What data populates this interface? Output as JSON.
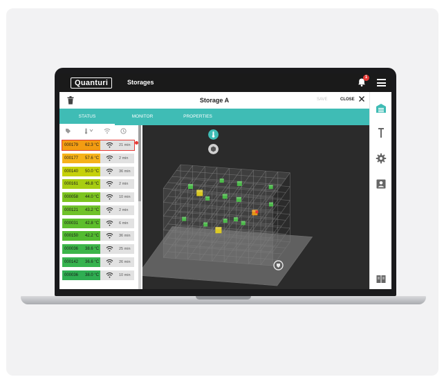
{
  "app": {
    "logo": "Quanturi",
    "section_title": "Storages",
    "notification_count": "1"
  },
  "header": {
    "title": "Storage A",
    "save_label": "SAVE",
    "close_label": "CLOSE"
  },
  "tabs": [
    {
      "label": "STATUS",
      "active": true
    },
    {
      "label": "MONITOR",
      "active": false
    },
    {
      "label": "PROPERTIES",
      "active": false
    }
  ],
  "list_columns": [
    "tag-icon",
    "temperature-icon",
    "signal-icon",
    "clock-icon"
  ],
  "sensors": [
    {
      "id": "000179",
      "temp": "62.3 °C",
      "time": "21 min",
      "color": "#f39c12",
      "selected": true
    },
    {
      "id": "000177",
      "temp": "57.6 °C",
      "time": "2 min",
      "color": "#f6b21a",
      "selected": false
    },
    {
      "id": "000140",
      "temp": "50.0 °C",
      "time": "36 min",
      "color": "#c6d10a",
      "selected": false
    },
    {
      "id": "000161",
      "temp": "46.8 °C",
      "time": "2 min",
      "color": "#a8cd12",
      "selected": false
    },
    {
      "id": "000058",
      "temp": "44.0 °C",
      "time": "10 min",
      "color": "#7dc420",
      "selected": false
    },
    {
      "id": "000121",
      "temp": "43.2 °C",
      "time": "2 min",
      "color": "#6fc22a",
      "selected": false
    },
    {
      "id": "000031",
      "temp": "42.8 °C",
      "time": "6 min",
      "color": "#5dbe2c",
      "selected": false
    },
    {
      "id": "000150",
      "temp": "42.2 °C",
      "time": "36 min",
      "color": "#52bb30",
      "selected": false
    },
    {
      "id": "000036",
      "temp": "38.6 °C",
      "time": "25 min",
      "color": "#3cb54a",
      "selected": false
    },
    {
      "id": "000142",
      "temp": "36.6 °C",
      "time": "26 min",
      "color": "#36b34f",
      "selected": false
    },
    {
      "id": "000036",
      "temp": "38.0 °C",
      "time": "10 min",
      "color": "#2fae52",
      "selected": false
    }
  ],
  "colors": {
    "accent": "#3fbcb5",
    "alert": "#e53935",
    "hot": "#f39c12",
    "warm": "#e6d31e",
    "cool": "#4cc34a"
  }
}
